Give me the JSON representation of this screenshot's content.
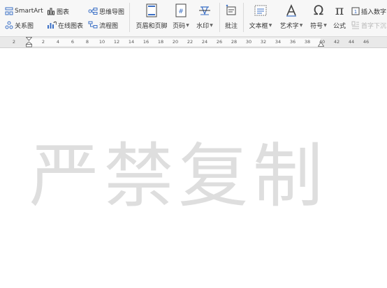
{
  "ribbon": {
    "smartart": "SmartArt",
    "chart": "图表",
    "mindmap": "思维导图",
    "relation": "关系图",
    "online_chart": "在线图表",
    "flowchart": "流程图",
    "header_footer": "页眉和页脚",
    "page_number": "页码",
    "watermark": "水印",
    "comment": "批注",
    "textbox": "文本框",
    "wordart": "艺术字",
    "symbol": "符号",
    "formula": "公式",
    "insert_number": "插入数字",
    "first_drop": "首字下沉"
  },
  "ruler": {
    "numbers": [
      "2",
      "2",
      "4",
      "6",
      "8",
      "10",
      "12",
      "14",
      "16",
      "18",
      "20",
      "22",
      "24",
      "26",
      "28",
      "30",
      "32",
      "34",
      "36",
      "38",
      "40",
      "42",
      "44",
      "46"
    ]
  },
  "document": {
    "watermark_chars": [
      "严",
      "禁",
      "复",
      "制"
    ]
  },
  "colors": {
    "ribbon_bg": "#f7f7f7",
    "icon_blue": "#3a6fc6",
    "watermark": "#dedede"
  }
}
